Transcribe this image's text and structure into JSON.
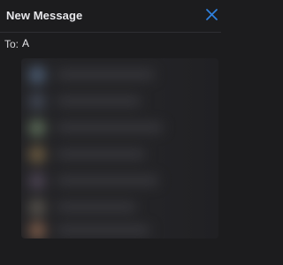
{
  "window": {
    "title": "New Message"
  },
  "compose": {
    "to_label": "To:",
    "to_value": "A",
    "to_placeholder": ""
  },
  "icons": {
    "close": "close-icon"
  },
  "colors": {
    "accent": "#2f7fdc",
    "background": "#1c1c1e",
    "text": "#e6e6ea"
  },
  "suggestions": {
    "count_visible": 7,
    "obscured": true,
    "avatar_colors": [
      "#4a5a70",
      "#3e4450",
      "#5a6a56",
      "#6a5a40",
      "#4a4250",
      "#54504a",
      "#7a5a48"
    ]
  }
}
